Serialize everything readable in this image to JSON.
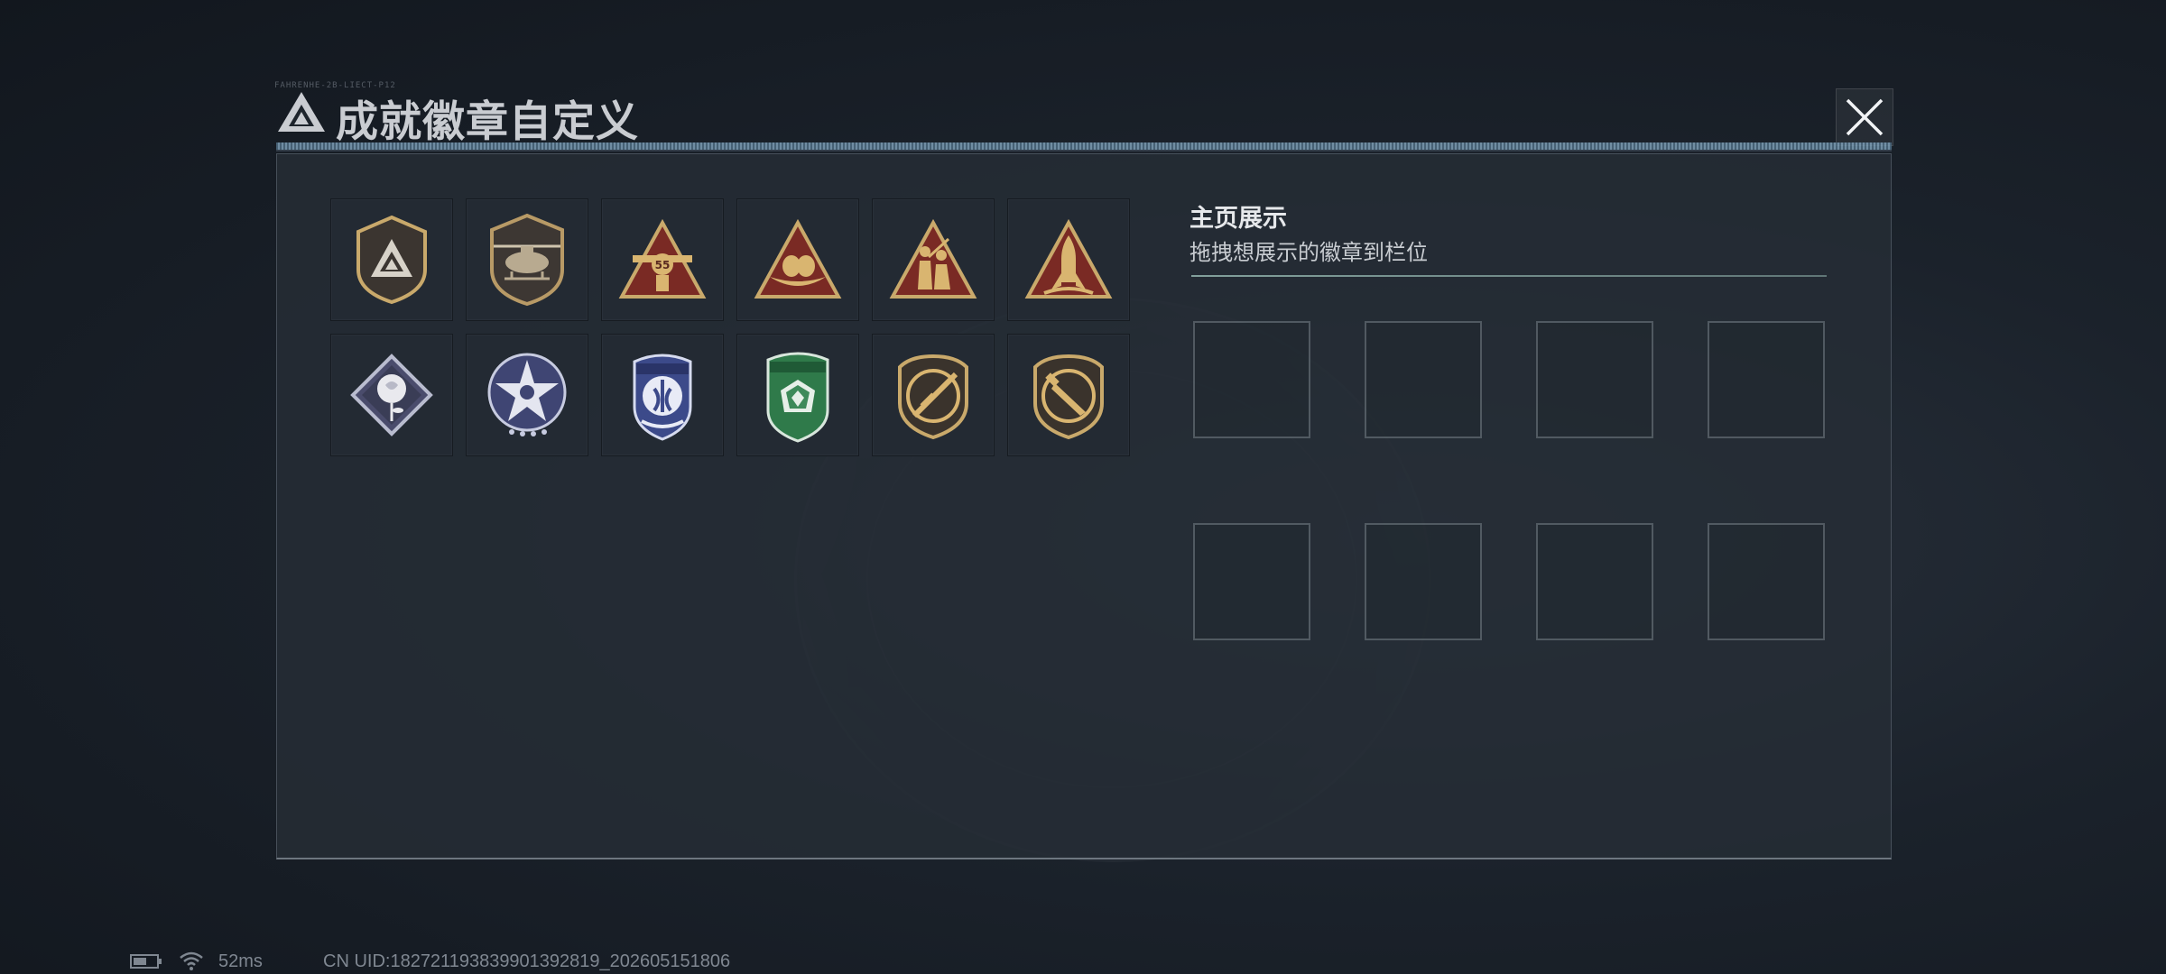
{
  "header": {
    "title": "成就徽章自定义",
    "deco_text": "FAHRENHE-2B-LIECT-P12",
    "icon": "triangle-logo-icon"
  },
  "close_button": {
    "icon": "close-x-icon"
  },
  "badges": [
    {
      "name": "badge-shield-triangle",
      "icon": "triangle-shield-badge"
    },
    {
      "name": "badge-helicopter",
      "icon": "helicopter-shield-badge"
    },
    {
      "name": "badge-55-plane",
      "icon": "plane-55-triangle-badge"
    },
    {
      "name": "badge-eagle-nest",
      "icon": "nest-triangle-badge"
    },
    {
      "name": "badge-soldiers",
      "icon": "soldiers-triangle-badge"
    },
    {
      "name": "badge-rocket",
      "icon": "rocket-triangle-badge"
    },
    {
      "name": "badge-rose",
      "icon": "rose-diamond-badge"
    },
    {
      "name": "badge-star-eagle",
      "icon": "star-eagle-badge"
    },
    {
      "name": "badge-blue-wings",
      "icon": "blue-wings-badge"
    },
    {
      "name": "badge-green-gem",
      "icon": "green-gem-badge"
    },
    {
      "name": "badge-rifle",
      "icon": "rifle-shield-badge"
    },
    {
      "name": "badge-knife",
      "icon": "knife-shield-badge"
    }
  ],
  "display": {
    "title": "主页展示",
    "subtitle": "拖拽想展示的徽章到栏位",
    "slot_count": 8
  },
  "status_bar": {
    "battery_icon": "battery-icon",
    "wifi_icon": "wifi-icon",
    "ping": "52ms",
    "uid": "CN UID:18272119383990139281​9_202605151806"
  },
  "colors": {
    "gold": "#c9a96b",
    "bronze": "#7a2a24",
    "panel": "#262d36",
    "accent_line": "#aad2c8"
  }
}
